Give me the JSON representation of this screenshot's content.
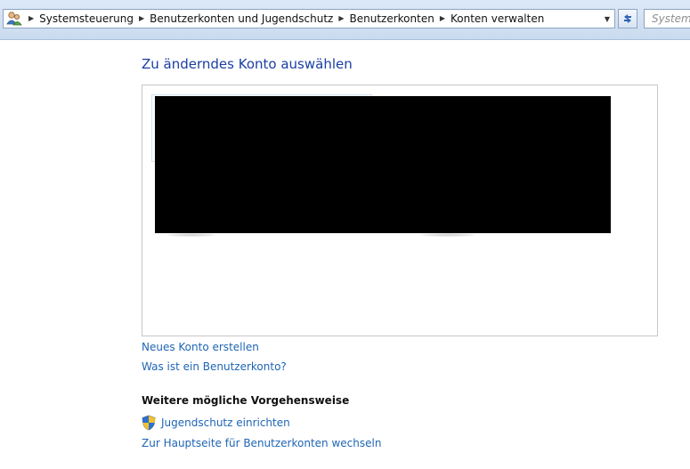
{
  "address_bar": {
    "breadcrumbs": [
      "Systemsteuerung",
      "Benutzerkonten und Jugendschutz",
      "Benutzerkonten",
      "Konten verwalten"
    ],
    "separator_icon": "chevron-right-icon",
    "dropdown_icon": "chevron-down-icon",
    "refresh_icon": "refresh-icon"
  },
  "search": {
    "placeholder": "Systemsteuerung durchsuchen"
  },
  "main": {
    "title": "Zu änderndes Konto auswählen",
    "links": {
      "new_account": "Neues Konto erstellen",
      "what_is_account": "Was ist ein Benutzerkonto?"
    },
    "more_options": {
      "heading": "Weitere mögliche Vorgehensweise",
      "parental_controls": "Jugendschutz einrichten",
      "main_page": "Zur Hauptseite für Benutzerkonten wechseln"
    }
  },
  "colors": {
    "title": "#1a3ea3",
    "link": "#1e65b5",
    "redaction": "#000000"
  }
}
